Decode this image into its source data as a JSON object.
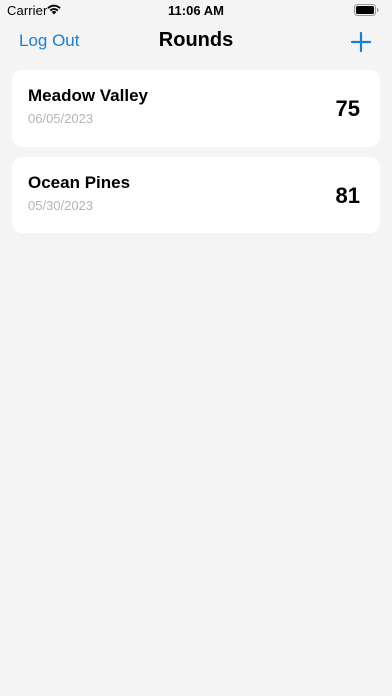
{
  "status_bar": {
    "carrier": "Carrier",
    "time": "11:06 AM",
    "wifi_icon": "wifi-icon",
    "battery_icon": "battery-icon"
  },
  "nav": {
    "left_label": "Log Out",
    "title": "Rounds",
    "right_icon": "plus-icon",
    "accent_color": "#1a7fd4"
  },
  "rounds": [
    {
      "course": "Meadow Valley",
      "date": "06/05/2023",
      "score": "75"
    },
    {
      "course": "Ocean Pines",
      "date": "05/30/2023",
      "score": "81"
    }
  ],
  "colors": {
    "background": "#f4f4f4",
    "card": "#ffffff",
    "date_text": "#b4b4b4"
  }
}
